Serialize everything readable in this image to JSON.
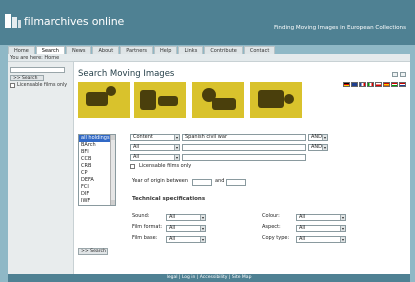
{
  "header": {
    "logo_text": "filmarchives online",
    "tagline": "Finding Moving Images in European Collections"
  },
  "nav": {
    "tabs": [
      "Home",
      "Search",
      "News",
      "About",
      "Partners",
      "Help",
      "Links",
      "Contribute",
      "Contact"
    ],
    "active": "Search"
  },
  "breadcrumb": "You are here: Home",
  "sidebar": {
    "search_value": "",
    "search_button": ">> Search",
    "licensable_label": "Licensable films only"
  },
  "main": {
    "title": "Search Moving Images",
    "holdings": [
      "all holdings",
      "BArch",
      "BFI",
      "CCB",
      "CRB",
      "CP",
      "DEFA",
      "FCI",
      "DIF",
      "IWF"
    ],
    "criteria": [
      {
        "field": "Content",
        "value": "Spanish civil war",
        "operator": "AND"
      },
      {
        "field": "All",
        "value": "",
        "operator": "AND"
      },
      {
        "field": "All",
        "value": ""
      }
    ],
    "licensable_label": "Licensable films only",
    "year_label": "Year of origin between",
    "year_and": "and",
    "tech_heading": "Technical specifications",
    "tech": {
      "sound_label": "Sound:",
      "sound": "All",
      "colour_label": "Colour:",
      "colour": "All",
      "format_label": "Film format:",
      "format": "All",
      "aspect_label": "Aspect:",
      "aspect": "All",
      "base_label": "Film base:",
      "base": "All",
      "copy_label": "Copy type:",
      "copy": "All"
    },
    "search_button": ">> Search"
  },
  "footer": "legal | Log in | Accessibility | Site Map",
  "colors": {
    "header": "#4f8193",
    "background": "#8fb8c6",
    "thumb_yellow": "#d9c22c",
    "selection": "#3169c6"
  },
  "icons": [
    "print-icon",
    "bookmark-icon"
  ]
}
